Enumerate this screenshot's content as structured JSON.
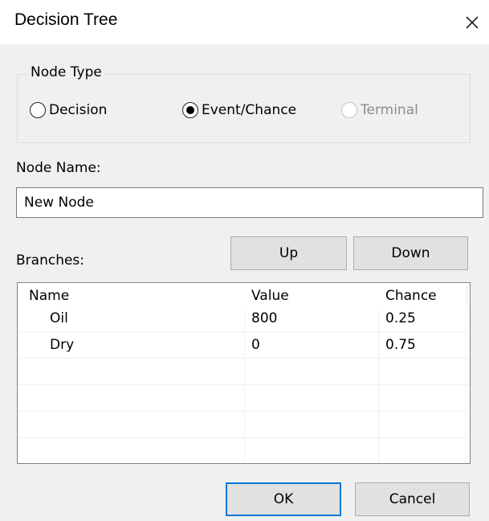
{
  "window": {
    "title": "Decision Tree",
    "close_icon": "close-icon"
  },
  "node_type": {
    "legend": "Node Type",
    "options": [
      {
        "label": "Decision",
        "checked": false,
        "enabled": true
      },
      {
        "label": "Event/Chance",
        "checked": true,
        "enabled": true
      },
      {
        "label": "Terminal",
        "checked": false,
        "enabled": false
      }
    ]
  },
  "node_name": {
    "label": "Node Name:",
    "value": "New Node"
  },
  "branches": {
    "label": "Branches:",
    "up_label": "Up",
    "down_label": "Down",
    "columns": [
      "Name",
      "Value",
      "Chance"
    ],
    "rows": [
      {
        "name": "Oil",
        "value": "800",
        "chance": "0.25"
      },
      {
        "name": "Dry",
        "value": "0",
        "chance": "0.75"
      }
    ]
  },
  "buttons": {
    "ok_label": "OK",
    "cancel_label": "Cancel"
  },
  "colors": {
    "dialog_bg": "#f0f0f0",
    "titlebar_bg": "#ffffff",
    "default_button_border": "#0078d7",
    "disabled_text": "#8c8c8c"
  }
}
